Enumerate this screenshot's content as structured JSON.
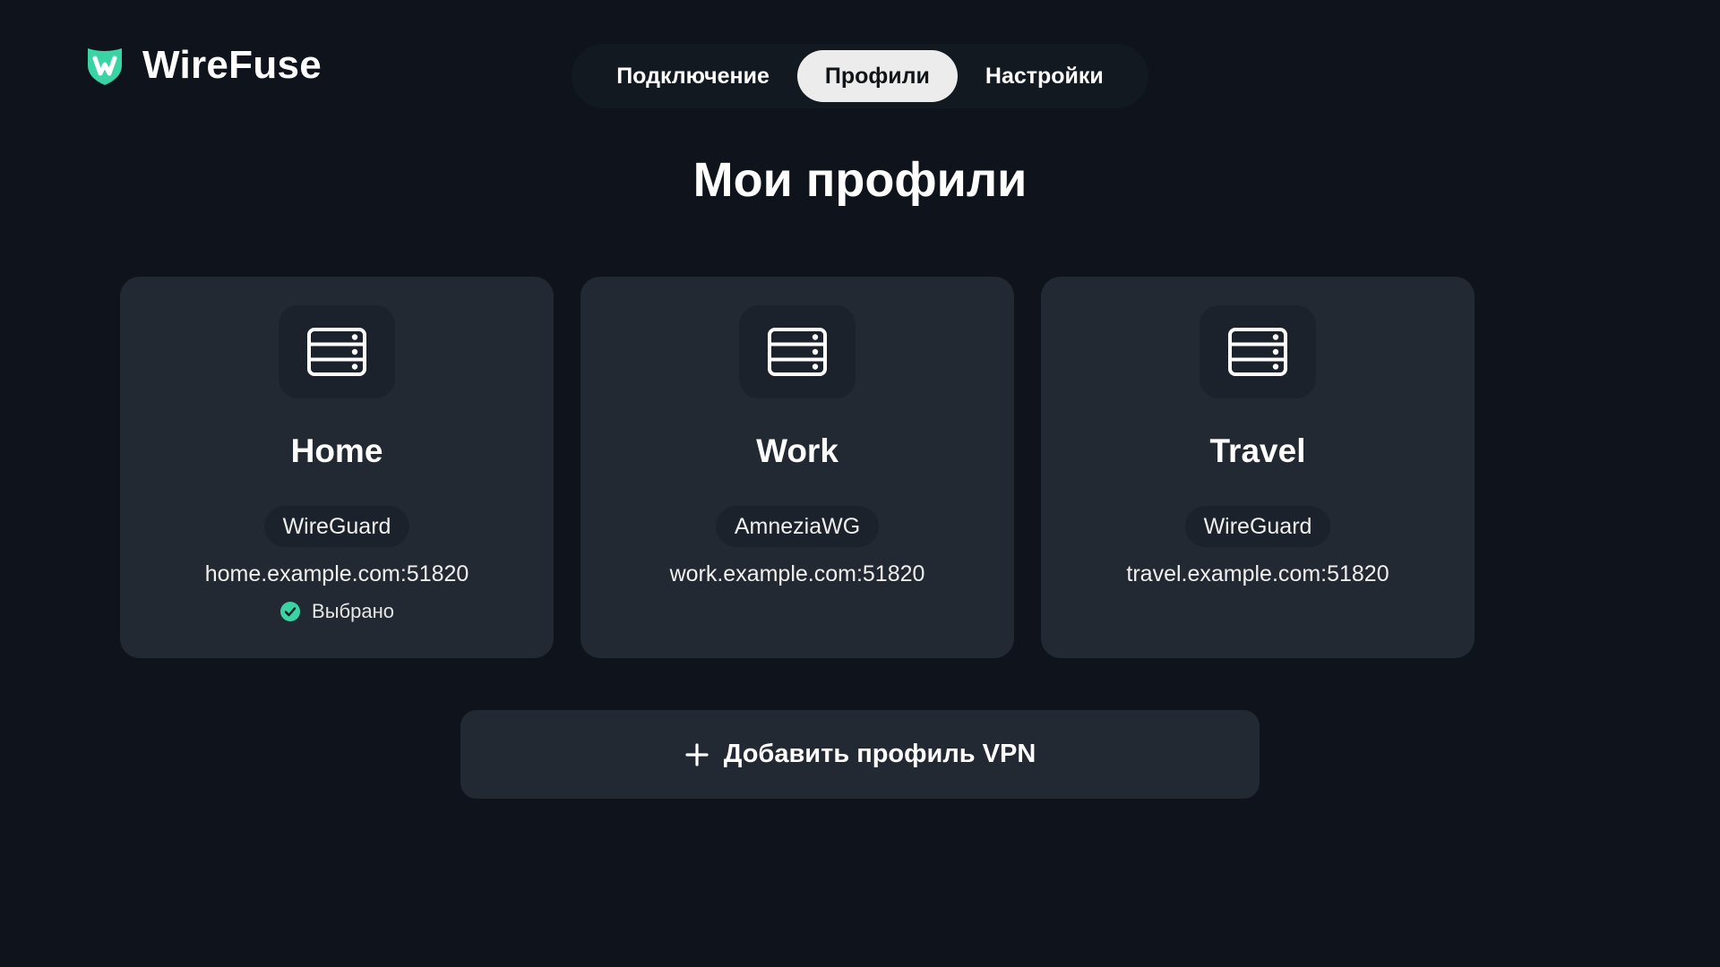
{
  "app": {
    "name": "WireFuse",
    "logo_icon": "shield-w-logo-icon",
    "accent_color": "#3ad3a4"
  },
  "nav": {
    "tabs": [
      {
        "label": "Подключение",
        "active": false
      },
      {
        "label": "Профили",
        "active": true
      },
      {
        "label": "Настройки",
        "active": false
      }
    ]
  },
  "main": {
    "title": "Мои профили",
    "profiles": [
      {
        "name": "Home",
        "icon": "server-icon",
        "protocol": "WireGuard",
        "endpoint": "home.example.com:51820",
        "selected": true,
        "selected_label": "Выбрано"
      },
      {
        "name": "Work",
        "icon": "server-icon",
        "protocol": "AmneziaWG",
        "endpoint": "work.example.com:51820",
        "selected": false
      },
      {
        "name": "Travel",
        "icon": "server-icon",
        "protocol": "WireGuard",
        "endpoint": "travel.example.com:51820",
        "selected": false
      }
    ],
    "add_button": {
      "label": "Добавить профиль VPN",
      "icon": "plus-icon"
    }
  }
}
